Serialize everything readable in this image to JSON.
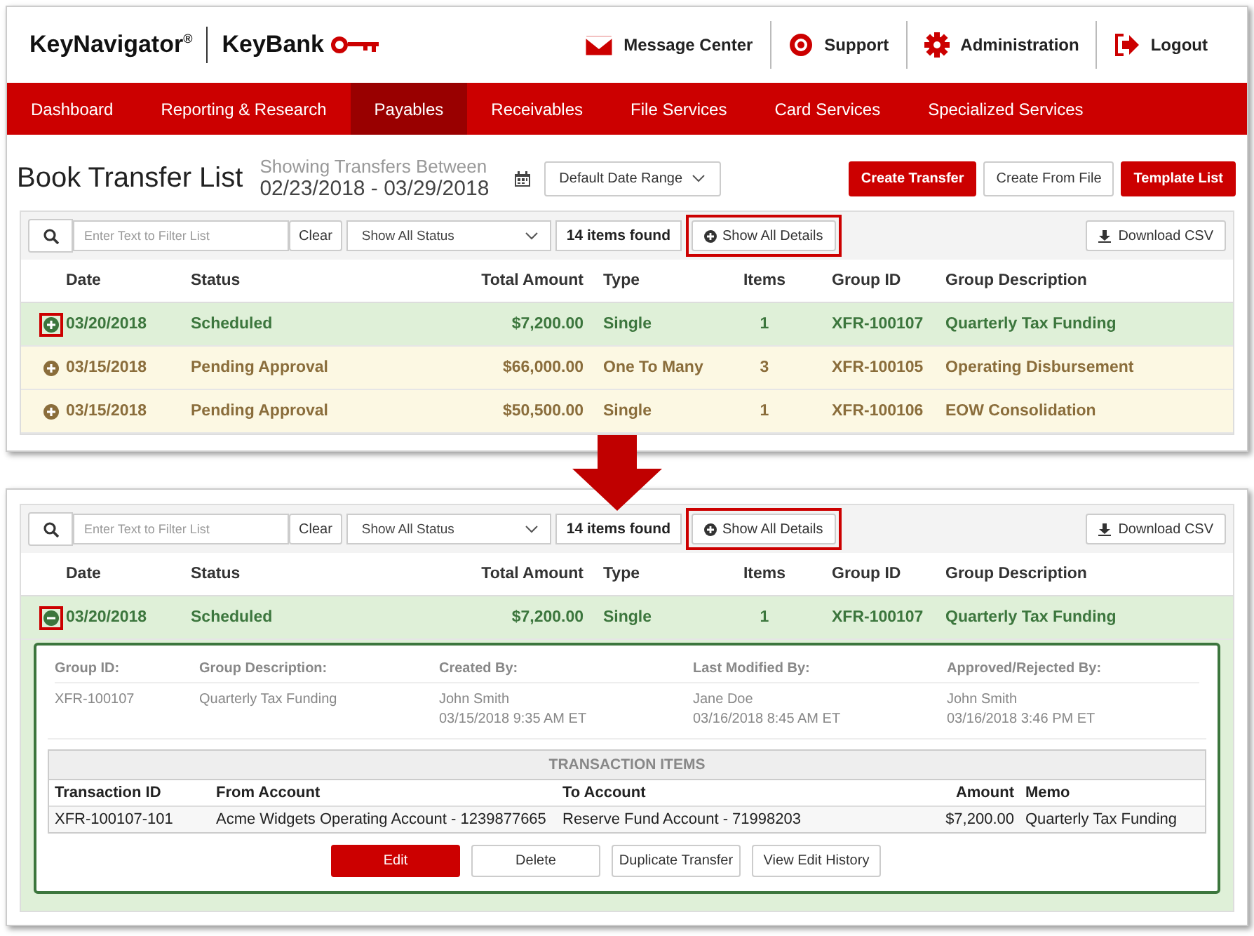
{
  "header": {
    "brand": "KeyNavigator$^{®}$",
    "bank": "KeyBank",
    "links": [
      {
        "label": "Message Center"
      },
      {
        "label": "Support"
      },
      {
        "label": "Administration"
      },
      {
        "label": "Logout"
      }
    ]
  },
  "nav": [
    {
      "label": "Dashboard",
      "selected": false
    },
    {
      "label": "Reporting & Research",
      "selected": false
    },
    {
      "label": "Payables",
      "selected": true
    },
    {
      "label": "Receivables",
      "selected": false
    },
    {
      "label": "File Services",
      "selected": false
    },
    {
      "label": "Card Services",
      "selected": false
    },
    {
      "label": "Specialized Services",
      "selected": false
    }
  ],
  "page": {
    "title": "Book Transfer List",
    "range_caption": "Showing Transfers Between",
    "range_dates": "02/23/2018 - 03/29/2018",
    "date_range_button": "Default Date Range",
    "actions": [
      {
        "label": "Create Transfer",
        "kind": "primary"
      },
      {
        "label": "Create From File",
        "kind": "secondary"
      },
      {
        "label": "Template List",
        "kind": "primary"
      }
    ]
  },
  "views": [
    {
      "toolbar": {
        "filter_placeholder": "Enter Text to Filter List",
        "clear": "Clear",
        "status_select": "Show All Status",
        "count": "14 items found",
        "show_details": {
          "label": "Show All Details",
          "callout": true
        },
        "download": "Download CSV"
      },
      "columns": [
        "Date",
        "Status",
        "Total Amount",
        "Type",
        "Items",
        "Group ID",
        "Group Description"
      ],
      "rows": [
        {
          "kind": "scheduled",
          "expanded": false,
          "callout": true,
          "cells": [
            "03/20/2018",
            "Scheduled",
            "$7,200.00",
            "Single",
            "1",
            "XFR-100107",
            "Quarterly Tax Funding"
          ]
        },
        {
          "kind": "pending",
          "expanded": false,
          "callout": false,
          "cells": [
            "03/15/2018",
            "Pending Approval",
            "$66,000.00",
            "One To Many",
            "3",
            "XFR-100105",
            "Operating Disbursement"
          ]
        },
        {
          "kind": "pending",
          "expanded": false,
          "callout": false,
          "cells": [
            "03/15/2018",
            "Pending Approval",
            "$50,500.00",
            "Single",
            "1",
            "XFR-100106",
            "EOW Consolidation"
          ]
        }
      ]
    },
    {
      "toolbar": {
        "filter_placeholder": "Enter Text to Filter List",
        "clear": "Clear",
        "status_select": "Show All Status",
        "count": "14 items found",
        "show_details": {
          "label": "Show All Details",
          "callout": true
        },
        "download": "Download CSV"
      },
      "columns": [
        "Date",
        "Status",
        "Total Amount",
        "Type",
        "Items",
        "Group ID",
        "Group Description"
      ],
      "rows": [
        {
          "kind": "scheduled",
          "expanded": true,
          "callout": true,
          "cells": [
            "03/20/2018",
            "Scheduled",
            "$7,200.00",
            "Single",
            "1",
            "XFR-100107",
            "Quarterly Tax Funding"
          ],
          "detail": {
            "fields": [
              {
                "label": "Group ID:",
                "lines": [
                  "XFR-100107"
                ]
              },
              {
                "label": "Group Description:",
                "lines": [
                  "Quarterly Tax Funding"
                ]
              },
              {
                "label": "Created By:",
                "lines": [
                  "John Smith",
                  "03/15/2018 9:35 AM ET"
                ]
              },
              {
                "label": "Last Modified By:",
                "lines": [
                  "Jane Doe",
                  "03/16/2018 8:45 AM ET"
                ]
              },
              {
                "label": "Approved/Rejected By:",
                "lines": [
                  "John Smith",
                  "03/16/2018 3:46 PM ET"
                ]
              }
            ],
            "items_title": "TRANSACTION ITEMS",
            "item_columns": [
              "Transaction ID",
              "From Account",
              "To Account",
              "Amount",
              "Memo"
            ],
            "item_rows": [
              [
                "XFR-100107-101",
                "Acme Widgets Operating Account - 1239877665",
                "Reserve Fund Account - 71998203",
                "$7,200.00",
                "Quarterly Tax Funding"
              ]
            ],
            "buttons": [
              {
                "label": "Edit",
                "kind": "primary"
              },
              {
                "label": "Delete",
                "kind": "secondary"
              },
              {
                "label": "Duplicate Transfer",
                "kind": "secondary"
              },
              {
                "label": "View Edit History",
                "kind": "secondary"
              }
            ]
          }
        }
      ]
    }
  ]
}
